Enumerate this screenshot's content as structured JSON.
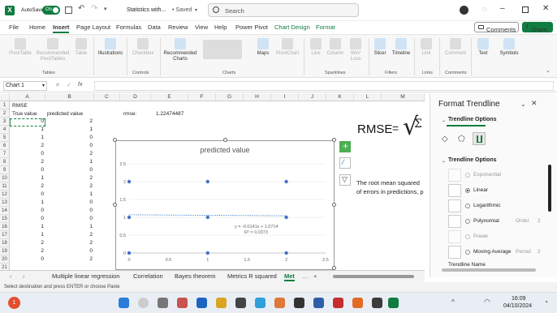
{
  "titlebar": {
    "autosave": "AutoSave",
    "toggle": "On",
    "filename": "Statistics with...",
    "saved": "• Saved",
    "search_placeholder": "Search"
  },
  "menu": [
    "File",
    "Home",
    "Insert",
    "Page Layout",
    "Formulas",
    "Data",
    "Review",
    "View",
    "Help",
    "Power Pivot",
    "Chart Design",
    "Format"
  ],
  "ribbon": {
    "comments": "Comments",
    "share": "Share",
    "groups": [
      "Tables",
      "Controls",
      "Charts",
      "Sparklines",
      "Filters",
      "Links",
      "Comments"
    ],
    "items": [
      "PivotTable",
      "Recommended PivotTables",
      "Table",
      "Illustrations",
      "Checkbox",
      "Recommended Charts",
      "Maps",
      "PivotChart",
      "Line",
      "Column",
      "Win/ Loss",
      "Slicer",
      "Timeline",
      "Link",
      "Comment",
      "Text",
      "Symbols"
    ]
  },
  "formula_bar": {
    "name_box": "Chart 1",
    "fx": "fx"
  },
  "columns": [
    "A",
    "B",
    "C",
    "D",
    "E",
    "F",
    "G",
    "H",
    "I",
    "J",
    "K",
    "L",
    "M"
  ],
  "rows": [
    "1",
    "2",
    "3",
    "4",
    "5",
    "6",
    "7",
    "8",
    "9",
    "10",
    "11",
    "12",
    "13",
    "14",
    "15",
    "16",
    "17",
    "18",
    "19",
    "20",
    "21"
  ],
  "cells": {
    "a1": "RMSE",
    "a2": "True value",
    "b2": "predicted value",
    "d2": "rmse:",
    "e2": "1.22474487",
    "true_vals": [
      "0",
      "1",
      "1",
      "2",
      "0",
      "2",
      "0",
      "1",
      "2",
      "0",
      "1",
      "0",
      "0",
      "1",
      "1",
      "2",
      "2",
      "0"
    ],
    "pred_vals": [
      "2",
      "1",
      "0",
      "0",
      "2",
      "1",
      "0",
      "2",
      "2",
      "1",
      "0",
      "0",
      "0",
      "1",
      "2",
      "2",
      "0",
      "2"
    ]
  },
  "image_text": {
    "rmse": "RMSE",
    "desc1": "The root mean squared",
    "desc2": "of errors in predictions, p"
  },
  "chart": {
    "title": "predicted value",
    "equation": "y = -0.0141x + 1.0714",
    "r2": "R² = 0.0373"
  },
  "chart_data": {
    "type": "scatter",
    "title": "predicted value",
    "x": [
      0,
      0,
      0,
      1,
      1,
      1,
      2,
      2,
      2
    ],
    "y": [
      0,
      1,
      2,
      0,
      1,
      2,
      0,
      1,
      2
    ],
    "xlim": [
      0,
      2.5
    ],
    "ylim": [
      0,
      2.5
    ],
    "xticks": [
      "0",
      "0.5",
      "1",
      "1.5",
      "2",
      "2.5"
    ],
    "yticks": [
      "0",
      "0.5",
      "1",
      "1.5",
      "2",
      "2.5"
    ],
    "trendline": {
      "slope": -0.0141,
      "intercept": 1.0714
    }
  },
  "pane": {
    "title": "Format Trendline",
    "section": "Trendline Options",
    "subsection": "Trendline Options",
    "options": [
      "Exponential",
      "Linear",
      "Logarithmic",
      "Polynomial",
      "Power",
      "Moving Average"
    ],
    "order_label": "Order",
    "order_value": "2",
    "period_label": "Period",
    "period_value": "2",
    "name_label": "Trendline Name"
  },
  "tabs": [
    "Multiple linear regression",
    "Correlation",
    "Bayes theorem",
    "Metrics R squared",
    "Met"
  ],
  "status": {
    "text": "Select destination and press ENTER or choose Paste"
  },
  "taskbar": {
    "time": "16:09",
    "date": "04/10/2024"
  },
  "colors": {
    "excel_green": "#107c41",
    "accent": "#217346"
  }
}
